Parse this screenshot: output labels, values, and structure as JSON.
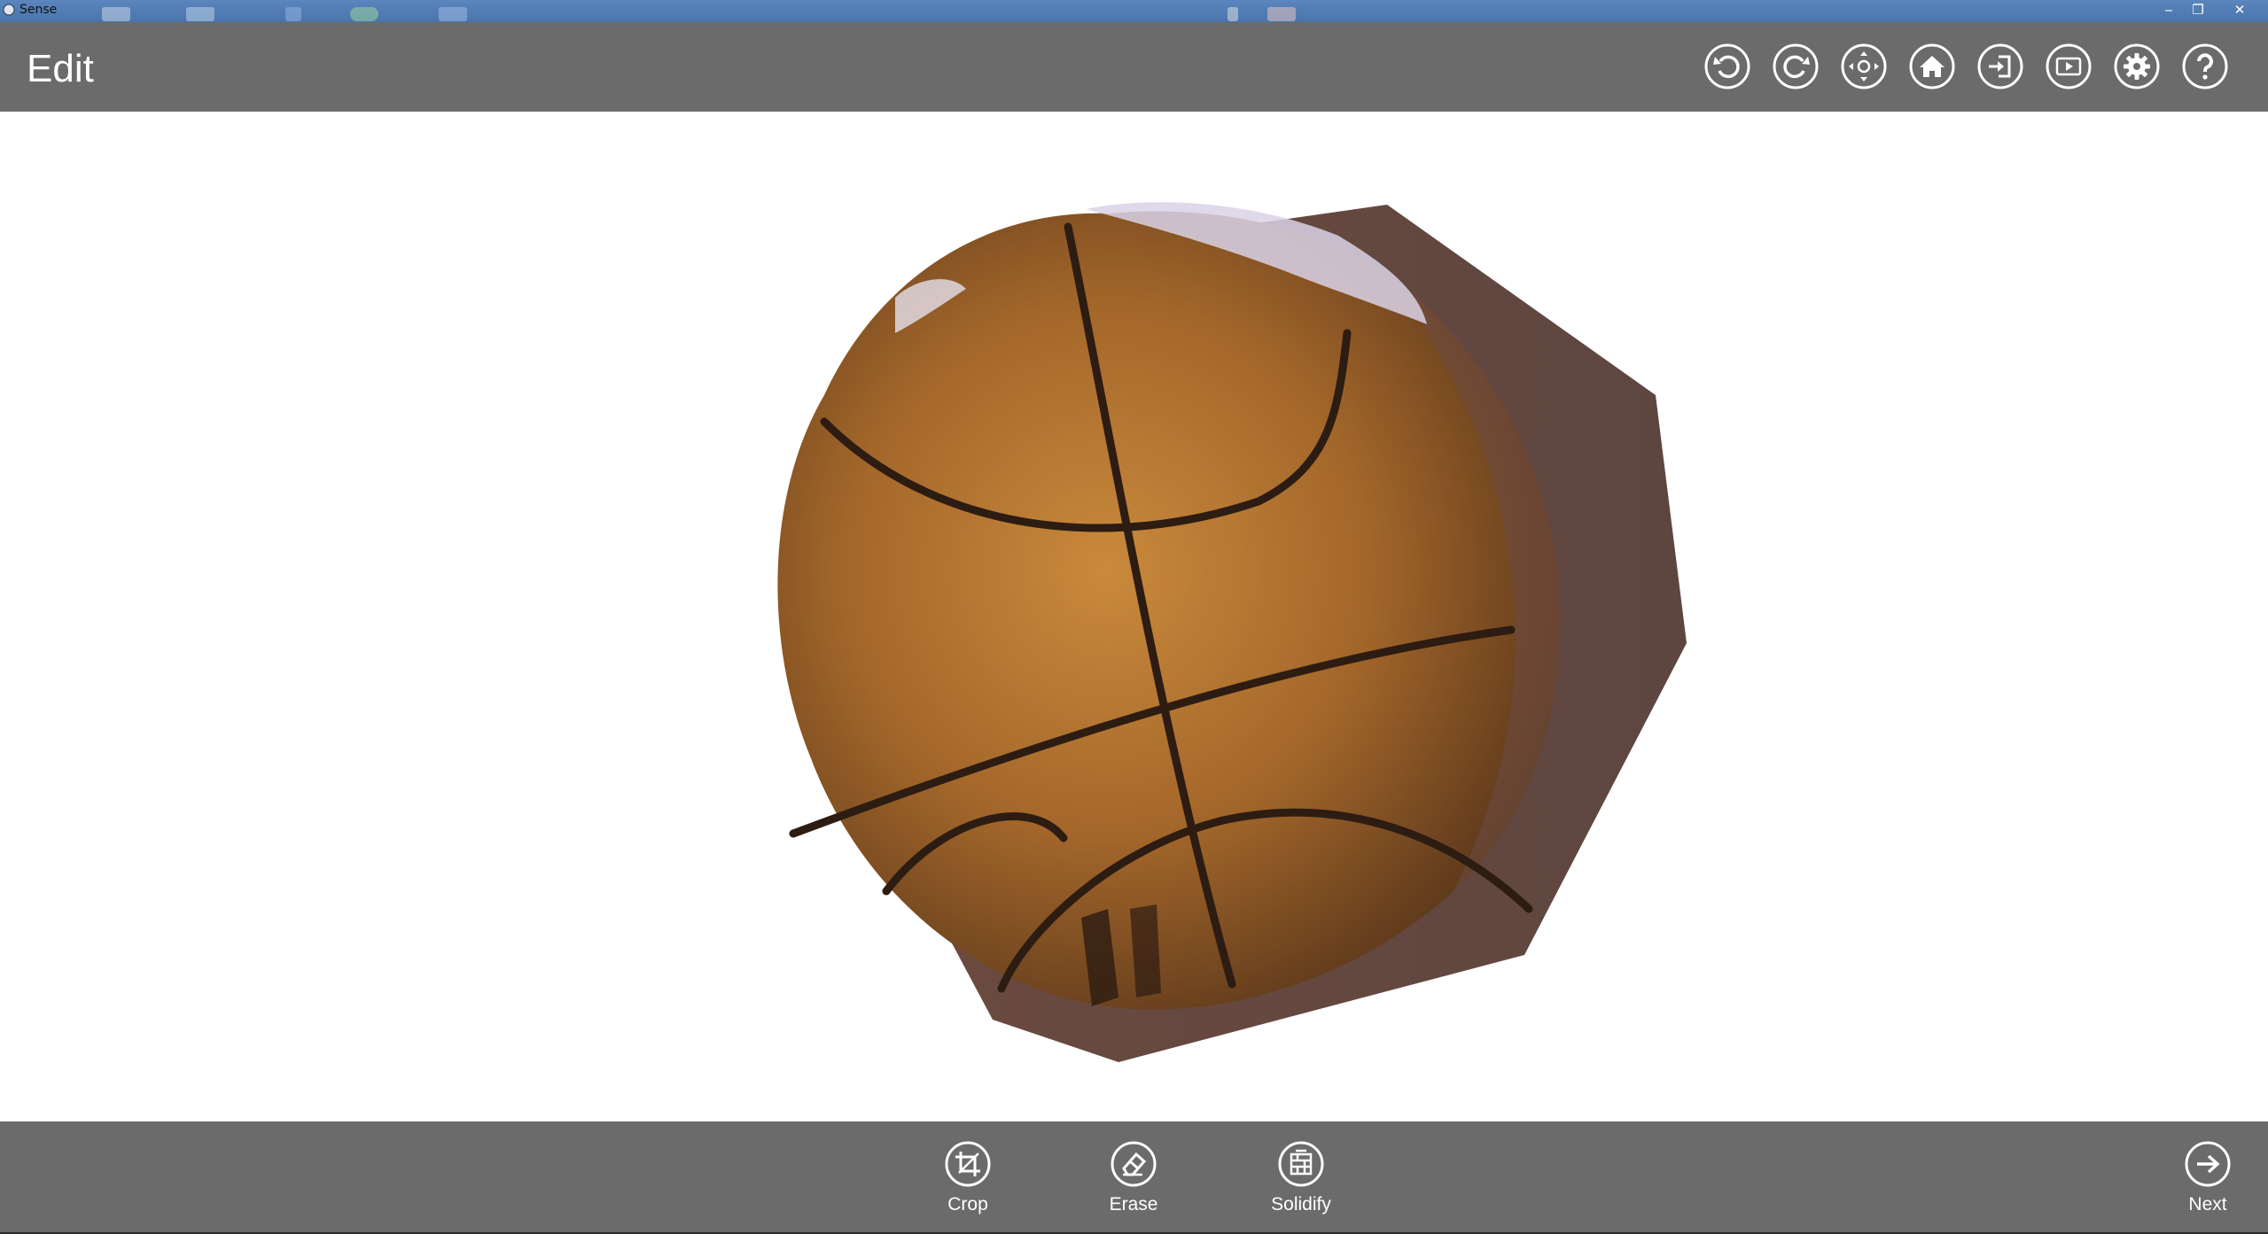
{
  "window": {
    "title": "Sense",
    "minimize_glyph": "‒",
    "restore_glyph": "❐",
    "close_glyph": "✕"
  },
  "header": {
    "title": "Edit",
    "icons": [
      "undo-icon",
      "redo-icon",
      "move-icon",
      "home-icon",
      "import-icon",
      "play-icon",
      "settings-icon",
      "help-icon"
    ]
  },
  "bottom_bar": {
    "tools": [
      {
        "label": "Crop",
        "icon": "crop-icon"
      },
      {
        "label": "Erase",
        "icon": "eraser-icon"
      },
      {
        "label": "Solidify",
        "icon": "solidify-icon"
      }
    ],
    "next_label": "Next"
  },
  "colors": {
    "bar": "#6b6b6b",
    "viewport": "#ffffff",
    "titlebar": "#4f7ab2",
    "icon_stroke": "#ffffff"
  }
}
